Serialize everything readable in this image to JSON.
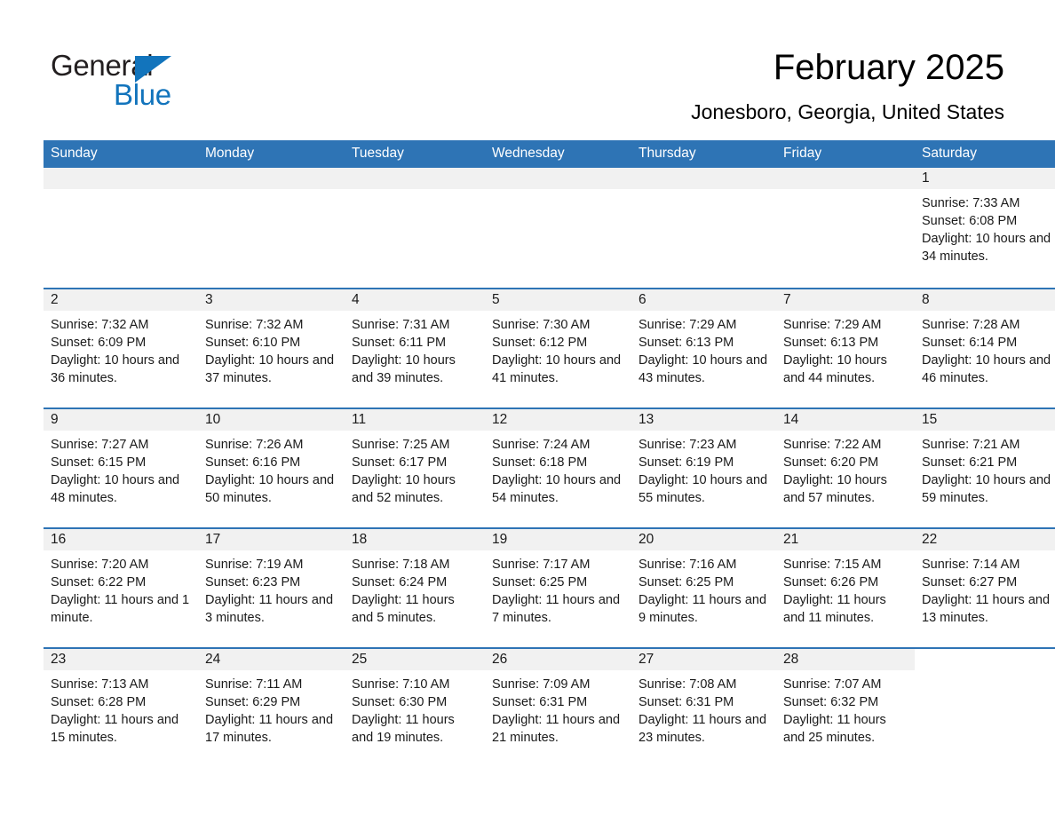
{
  "brand": {
    "name_part1": "General",
    "name_part2": "Blue"
  },
  "header": {
    "month_title": "February 2025",
    "location": "Jonesboro, Georgia, United States"
  },
  "colors": {
    "header_blue": "#2e74b5",
    "logo_blue": "#1274bc",
    "daynum_band": "#f1f1f1",
    "text": "#1a1a1a"
  },
  "weekday_headers": [
    "Sunday",
    "Monday",
    "Tuesday",
    "Wednesday",
    "Thursday",
    "Friday",
    "Saturday"
  ],
  "weeks": [
    [
      {
        "empty": true
      },
      {
        "empty": true
      },
      {
        "empty": true
      },
      {
        "empty": true
      },
      {
        "empty": true
      },
      {
        "empty": true
      },
      {
        "day": "1",
        "sunrise": "Sunrise: 7:33 AM",
        "sunset": "Sunset: 6:08 PM",
        "daylight": "Daylight: 10 hours and 34 minutes."
      }
    ],
    [
      {
        "day": "2",
        "sunrise": "Sunrise: 7:32 AM",
        "sunset": "Sunset: 6:09 PM",
        "daylight": "Daylight: 10 hours and 36 minutes."
      },
      {
        "day": "3",
        "sunrise": "Sunrise: 7:32 AM",
        "sunset": "Sunset: 6:10 PM",
        "daylight": "Daylight: 10 hours and 37 minutes."
      },
      {
        "day": "4",
        "sunrise": "Sunrise: 7:31 AM",
        "sunset": "Sunset: 6:11 PM",
        "daylight": "Daylight: 10 hours and 39 minutes."
      },
      {
        "day": "5",
        "sunrise": "Sunrise: 7:30 AM",
        "sunset": "Sunset: 6:12 PM",
        "daylight": "Daylight: 10 hours and 41 minutes."
      },
      {
        "day": "6",
        "sunrise": "Sunrise: 7:29 AM",
        "sunset": "Sunset: 6:13 PM",
        "daylight": "Daylight: 10 hours and 43 minutes."
      },
      {
        "day": "7",
        "sunrise": "Sunrise: 7:29 AM",
        "sunset": "Sunset: 6:13 PM",
        "daylight": "Daylight: 10 hours and 44 minutes."
      },
      {
        "day": "8",
        "sunrise": "Sunrise: 7:28 AM",
        "sunset": "Sunset: 6:14 PM",
        "daylight": "Daylight: 10 hours and 46 minutes."
      }
    ],
    [
      {
        "day": "9",
        "sunrise": "Sunrise: 7:27 AM",
        "sunset": "Sunset: 6:15 PM",
        "daylight": "Daylight: 10 hours and 48 minutes."
      },
      {
        "day": "10",
        "sunrise": "Sunrise: 7:26 AM",
        "sunset": "Sunset: 6:16 PM",
        "daylight": "Daylight: 10 hours and 50 minutes."
      },
      {
        "day": "11",
        "sunrise": "Sunrise: 7:25 AM",
        "sunset": "Sunset: 6:17 PM",
        "daylight": "Daylight: 10 hours and 52 minutes."
      },
      {
        "day": "12",
        "sunrise": "Sunrise: 7:24 AM",
        "sunset": "Sunset: 6:18 PM",
        "daylight": "Daylight: 10 hours and 54 minutes."
      },
      {
        "day": "13",
        "sunrise": "Sunrise: 7:23 AM",
        "sunset": "Sunset: 6:19 PM",
        "daylight": "Daylight: 10 hours and 55 minutes."
      },
      {
        "day": "14",
        "sunrise": "Sunrise: 7:22 AM",
        "sunset": "Sunset: 6:20 PM",
        "daylight": "Daylight: 10 hours and 57 minutes."
      },
      {
        "day": "15",
        "sunrise": "Sunrise: 7:21 AM",
        "sunset": "Sunset: 6:21 PM",
        "daylight": "Daylight: 10 hours and 59 minutes."
      }
    ],
    [
      {
        "day": "16",
        "sunrise": "Sunrise: 7:20 AM",
        "sunset": "Sunset: 6:22 PM",
        "daylight": "Daylight: 11 hours and 1 minute."
      },
      {
        "day": "17",
        "sunrise": "Sunrise: 7:19 AM",
        "sunset": "Sunset: 6:23 PM",
        "daylight": "Daylight: 11 hours and 3 minutes."
      },
      {
        "day": "18",
        "sunrise": "Sunrise: 7:18 AM",
        "sunset": "Sunset: 6:24 PM",
        "daylight": "Daylight: 11 hours and 5 minutes."
      },
      {
        "day": "19",
        "sunrise": "Sunrise: 7:17 AM",
        "sunset": "Sunset: 6:25 PM",
        "daylight": "Daylight: 11 hours and 7 minutes."
      },
      {
        "day": "20",
        "sunrise": "Sunrise: 7:16 AM",
        "sunset": "Sunset: 6:25 PM",
        "daylight": "Daylight: 11 hours and 9 minutes."
      },
      {
        "day": "21",
        "sunrise": "Sunrise: 7:15 AM",
        "sunset": "Sunset: 6:26 PM",
        "daylight": "Daylight: 11 hours and 11 minutes."
      },
      {
        "day": "22",
        "sunrise": "Sunrise: 7:14 AM",
        "sunset": "Sunset: 6:27 PM",
        "daylight": "Daylight: 11 hours and 13 minutes."
      }
    ],
    [
      {
        "day": "23",
        "sunrise": "Sunrise: 7:13 AM",
        "sunset": "Sunset: 6:28 PM",
        "daylight": "Daylight: 11 hours and 15 minutes."
      },
      {
        "day": "24",
        "sunrise": "Sunrise: 7:11 AM",
        "sunset": "Sunset: 6:29 PM",
        "daylight": "Daylight: 11 hours and 17 minutes."
      },
      {
        "day": "25",
        "sunrise": "Sunrise: 7:10 AM",
        "sunset": "Sunset: 6:30 PM",
        "daylight": "Daylight: 11 hours and 19 minutes."
      },
      {
        "day": "26",
        "sunrise": "Sunrise: 7:09 AM",
        "sunset": "Sunset: 6:31 PM",
        "daylight": "Daylight: 11 hours and 21 minutes."
      },
      {
        "day": "27",
        "sunrise": "Sunrise: 7:08 AM",
        "sunset": "Sunset: 6:31 PM",
        "daylight": "Daylight: 11 hours and 23 minutes."
      },
      {
        "day": "28",
        "sunrise": "Sunrise: 7:07 AM",
        "sunset": "Sunset: 6:32 PM",
        "daylight": "Daylight: 11 hours and 25 minutes."
      },
      {
        "blank": true
      }
    ]
  ]
}
